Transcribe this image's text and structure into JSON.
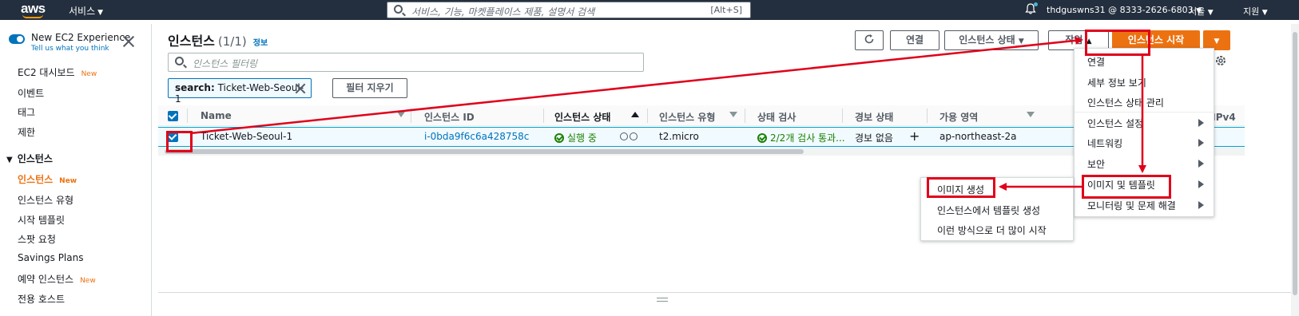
{
  "topnav": {
    "logo": "aws",
    "services": "서비스",
    "search_placeholder": "서비스, 기능, 마켓플레이스 제품, 설명서 검색",
    "search_shortcut": "[Alt+S]",
    "account": "thdguswns31 @ 8333-2626-6803",
    "region": "서울",
    "support": "지원"
  },
  "sidebar": {
    "new_experience": "New EC2 Experience",
    "tell_us": "Tell us what you think",
    "items": [
      {
        "label": "EC2 대시보드",
        "badge": "New"
      },
      {
        "label": "이벤트"
      },
      {
        "label": "태그"
      },
      {
        "label": "제한"
      }
    ],
    "section": "인스턴스",
    "sub_items": [
      {
        "label": "인스턴스",
        "badge": "New"
      },
      {
        "label": "인스턴스 유형"
      },
      {
        "label": "시작 템플릿"
      },
      {
        "label": "스팟 요청"
      },
      {
        "label": "Savings Plans"
      },
      {
        "label": "예약 인스턴스",
        "badge": "New"
      },
      {
        "label": "전용 호스트"
      }
    ]
  },
  "main": {
    "title": "인스턴스",
    "count": "(1/1)",
    "info": "정보",
    "buttons": {
      "connect": "연결",
      "instance_state": "인스턴스 상태",
      "actions": "작업",
      "launch": "인스턴스 시작"
    },
    "filter_placeholder": "인스턴스 필터링",
    "token_key": "search:",
    "token_value": "Ticket-Web-Seoul-1",
    "clear_filters": "필터 지우기",
    "page": "1"
  },
  "table": {
    "headers": [
      "Name",
      "인스턴스 ID",
      "인스턴스 상태",
      "인스턴스 유형",
      "상태 검사",
      "경보 상태",
      "가용 영역",
      "퍼블릭 IPv4 ..."
    ],
    "row": {
      "name": "Ticket-Web-Seoul-1",
      "instance_id": "i-0bda9f6c6a428758c",
      "state": "실행 중",
      "type": "t2.micro",
      "status_check": "2/2개 검사 통과...",
      "alarm": "경보 없음",
      "az": "ap-northeast-2a",
      "public_ip": "–"
    }
  },
  "actions_menu": {
    "items": [
      "연결",
      "세부 정보 보기",
      "인스턴스 상태 관리",
      "인스턴스 설정",
      "네트워킹",
      "보안",
      "이미지 및 템플릿",
      "모니터링 및 문제 해결"
    ]
  },
  "image_submenu": {
    "items": [
      "이미지 생성",
      "인스턴스에서 템플릿 생성",
      "이런 방식으로 더 많이 시작"
    ]
  },
  "colors": {
    "nav_bg": "#232f3e",
    "accent_orange": "#ec7211",
    "link_blue": "#0073bb",
    "success_green": "#1d8102",
    "annotation_red": "#e0001a"
  }
}
